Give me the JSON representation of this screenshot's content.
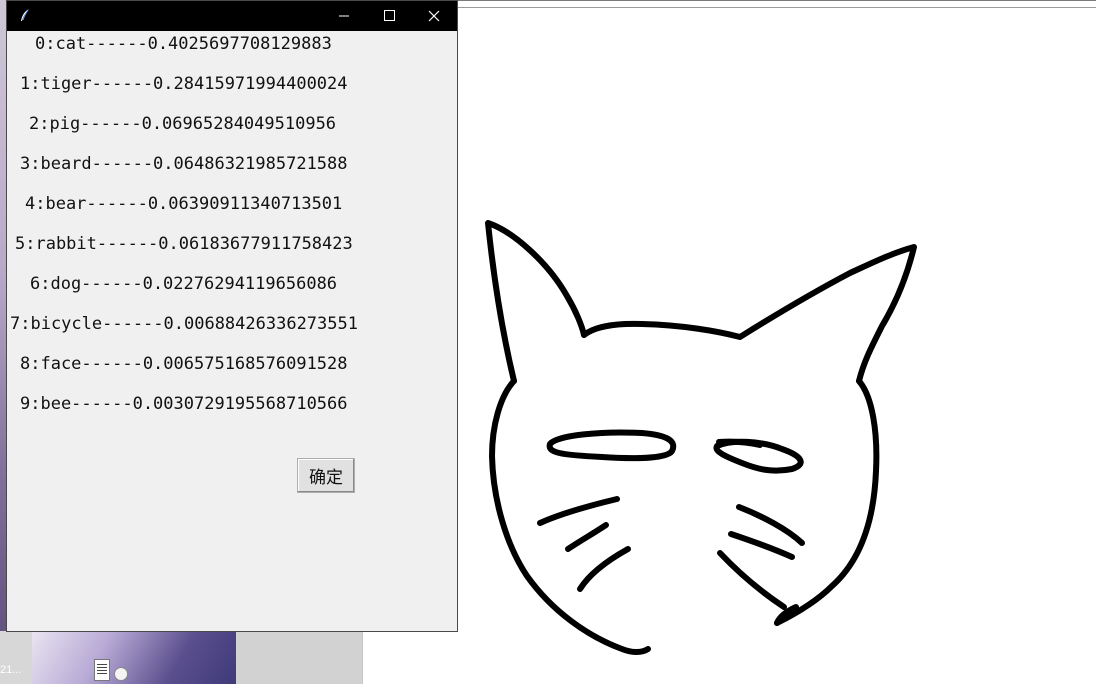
{
  "window": {
    "title": "",
    "minimize_label": "minimize",
    "maximize_label": "maximize",
    "close_label": "close"
  },
  "predictions": [
    {
      "text": "0:cat------0.4025697708129883"
    },
    {
      "text": "1:tiger------0.28415971994400024"
    },
    {
      "text": "2:pig------0.06965284049510956"
    },
    {
      "text": "3:beard------0.06486321985721588"
    },
    {
      "text": "4:bear------0.06390911340713501"
    },
    {
      "text": "5:rabbit------0.06183677911758423"
    },
    {
      "text": "6:dog------0.02276294119656086"
    },
    {
      "text": "7:bicycle------0.00688426336273551"
    },
    {
      "text": "8:face------0.006575168576091528"
    },
    {
      "text": "9:bee------0.0030729195568710566"
    }
  ],
  "buttons": {
    "ok_label": "确定"
  },
  "desktop": {
    "taskbar_label": "21..."
  },
  "canvas": {
    "stroke_color": "#000000",
    "background": "#ffffff",
    "drawing_subject": "cat sketch"
  },
  "colors": {
    "titlebar": "#000000",
    "window_bg": "#f0f0f0",
    "button_bg": "#e1e1e1"
  }
}
